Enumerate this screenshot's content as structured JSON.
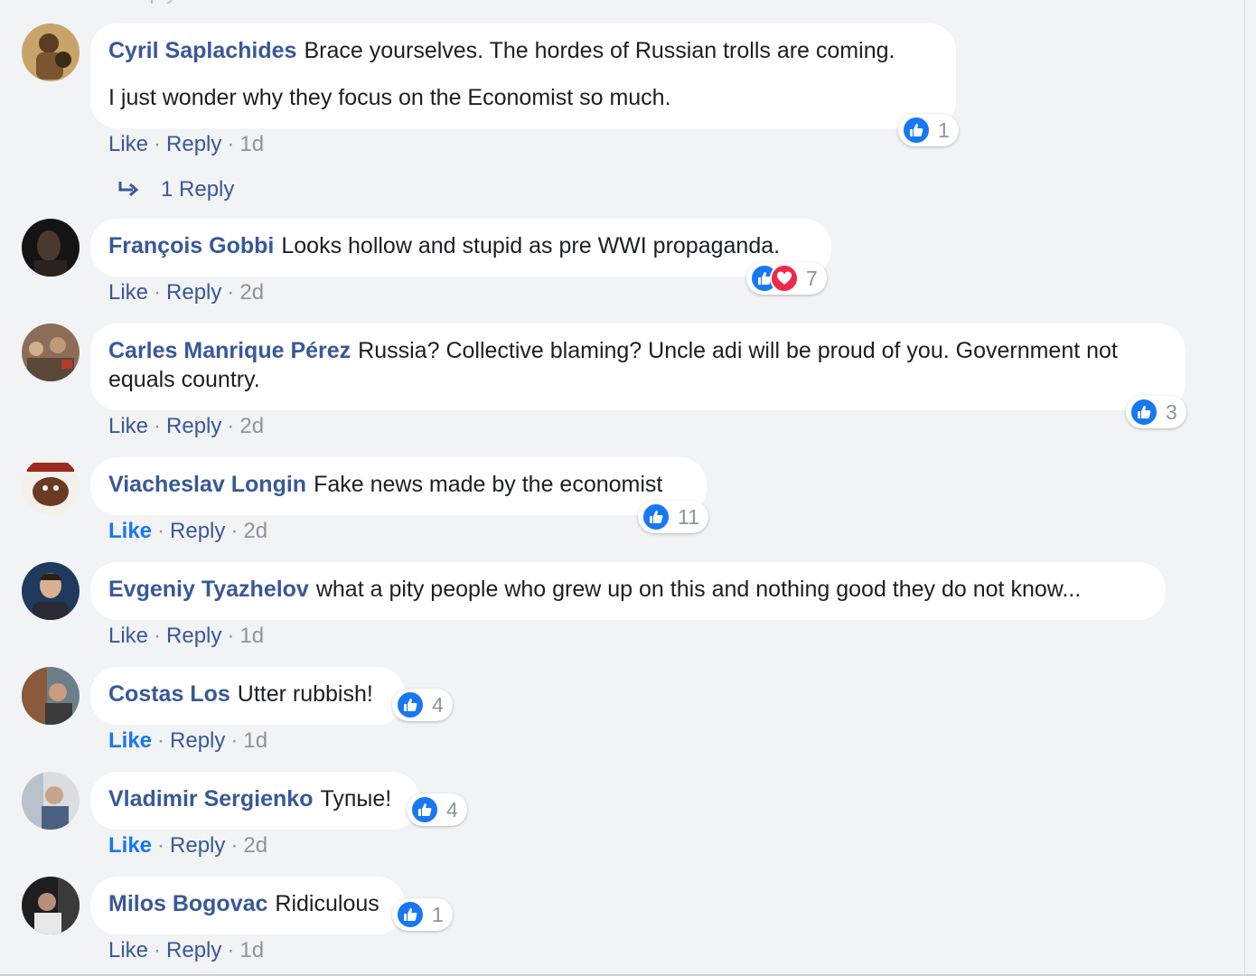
{
  "ui": {
    "like_label": "Like",
    "reply_label": "Reply",
    "separator": "·",
    "colors": {
      "link": "#385898",
      "like_blue": "#1877f2",
      "love_red": "#f0284a",
      "meta": "#8d949e",
      "background": "#f2f3f5"
    }
  },
  "comments": [
    {
      "author": "Cyril Saplachides",
      "text": "Brace yourselves. The hordes of Russian trolls are coming.",
      "text2": "I just wonder why they focus on the Economist so much.",
      "reaction_count": "1",
      "time": "1d",
      "replies_label": "1 Reply"
    },
    {
      "author": "François Gobbi",
      "text": "Looks hollow and stupid as pre WWI propaganda.",
      "reaction_count": "7",
      "time": "2d",
      "reactions": [
        "like-icon",
        "love-icon"
      ]
    },
    {
      "author": "Carles Manrique Pérez",
      "text": "Russia? Collective blaming? Uncle adi will be proud of you. Government not equals country.",
      "reaction_count": "3",
      "time": "2d"
    },
    {
      "author": "Viacheslav Longin",
      "text": "Fake news made by the economist",
      "reaction_count": "11",
      "time": "2d",
      "liked_by_viewer": true
    },
    {
      "author": "Evgeniy Tyazhelov",
      "text": "what a pity people who grew up on this and nothing good they do not know...",
      "time": "1d"
    },
    {
      "author": "Costas Los",
      "text": "Utter rubbish!",
      "reaction_count": "4",
      "time": "1d",
      "liked_by_viewer": true
    },
    {
      "author": "Vladimir Sergienko",
      "text": "Тупые!",
      "reaction_count": "4",
      "time": "2d",
      "liked_by_viewer": true
    },
    {
      "author": "Milos Bogovac",
      "text": "Ridiculous",
      "reaction_count": "1",
      "time": "1d"
    }
  ]
}
